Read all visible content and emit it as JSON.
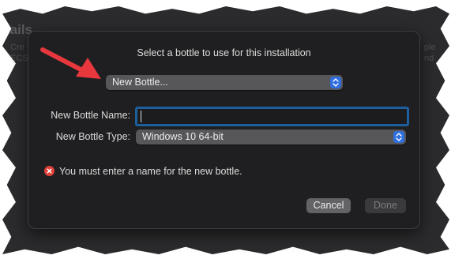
{
  "background": {
    "title": "tails",
    "left_fragments": [
      "Cre",
      "ECS",
      "ECS",
      "ECS"
    ],
    "right_fragments": [
      "ple",
      "nd"
    ]
  },
  "dialog": {
    "heading": "Select a bottle to use for this installation",
    "bottle_select": {
      "value": "New Bottle..."
    },
    "name_label": "New Bottle Name:",
    "name_value": "",
    "type_label": "New Bottle Type:",
    "type_select": {
      "value": "Windows 10 64-bit"
    },
    "error_message": "You must enter a name for the new bottle.",
    "cancel_label": "Cancel",
    "done_label": "Done"
  },
  "colors": {
    "accent": "#2f6fe0",
    "error": "#e0413a",
    "annotation_arrow": "#e8383d"
  },
  "icons": [
    "up-down-chevron-icon",
    "error-icon",
    "annotation-arrow-icon"
  ]
}
